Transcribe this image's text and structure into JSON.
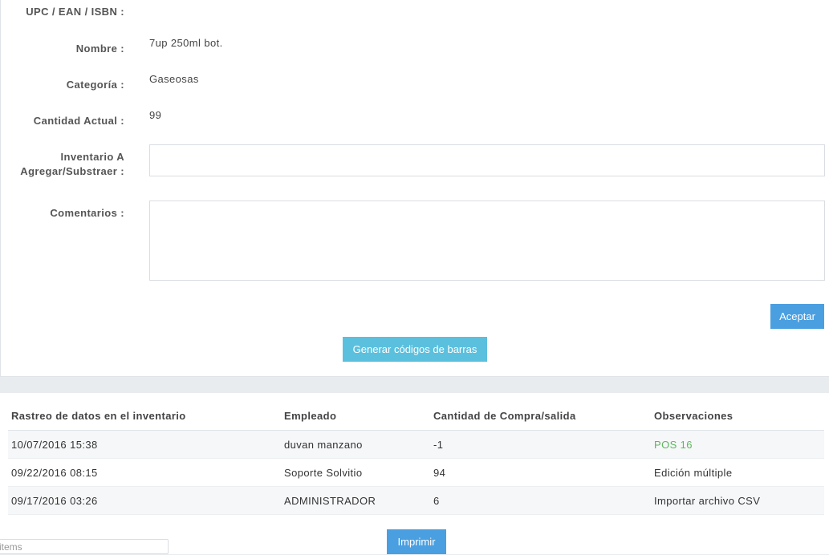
{
  "form": {
    "upc_label": "UPC / EAN / ISBN :",
    "upc_value": "",
    "name_label": "Nombre :",
    "name_value": "7up 250ml bot.",
    "category_label": "Categoría :",
    "category_value": "Gaseosas",
    "qty_label": "Cantidad Actual :",
    "qty_value": "99",
    "inventory_label_1": "Inventario A",
    "inventory_label_2": "Agregar/Substraer :",
    "inventory_value": "",
    "comments_label": "Comentarios :",
    "comments_value": "",
    "accept_label": "Aceptar",
    "barcode_label": "Generar códigos de barras"
  },
  "tracking": {
    "headers": [
      "Rastreo de datos en el inventario",
      "Empleado",
      "Cantidad de Compra/salida",
      "Observaciones"
    ],
    "rows": [
      {
        "date": "10/07/2016 15:38",
        "employee": "duvan manzano",
        "qty": "-1",
        "obs": "POS 16"
      },
      {
        "date": "09/22/2016 08:15",
        "employee": "Soporte Solvitio",
        "qty": "94",
        "obs": "Edición múltiple"
      },
      {
        "date": "09/17/2016 03:26",
        "employee": "ADMINISTRADOR",
        "qty": "6",
        "obs": "Importar archivo CSV"
      }
    ],
    "print_label": "Imprimir"
  },
  "footer": {
    "items_placeholder": "items"
  },
  "colors": {
    "primary": "#4a9fe0",
    "info": "#5bc0de",
    "link_green": "#5cb85c"
  }
}
